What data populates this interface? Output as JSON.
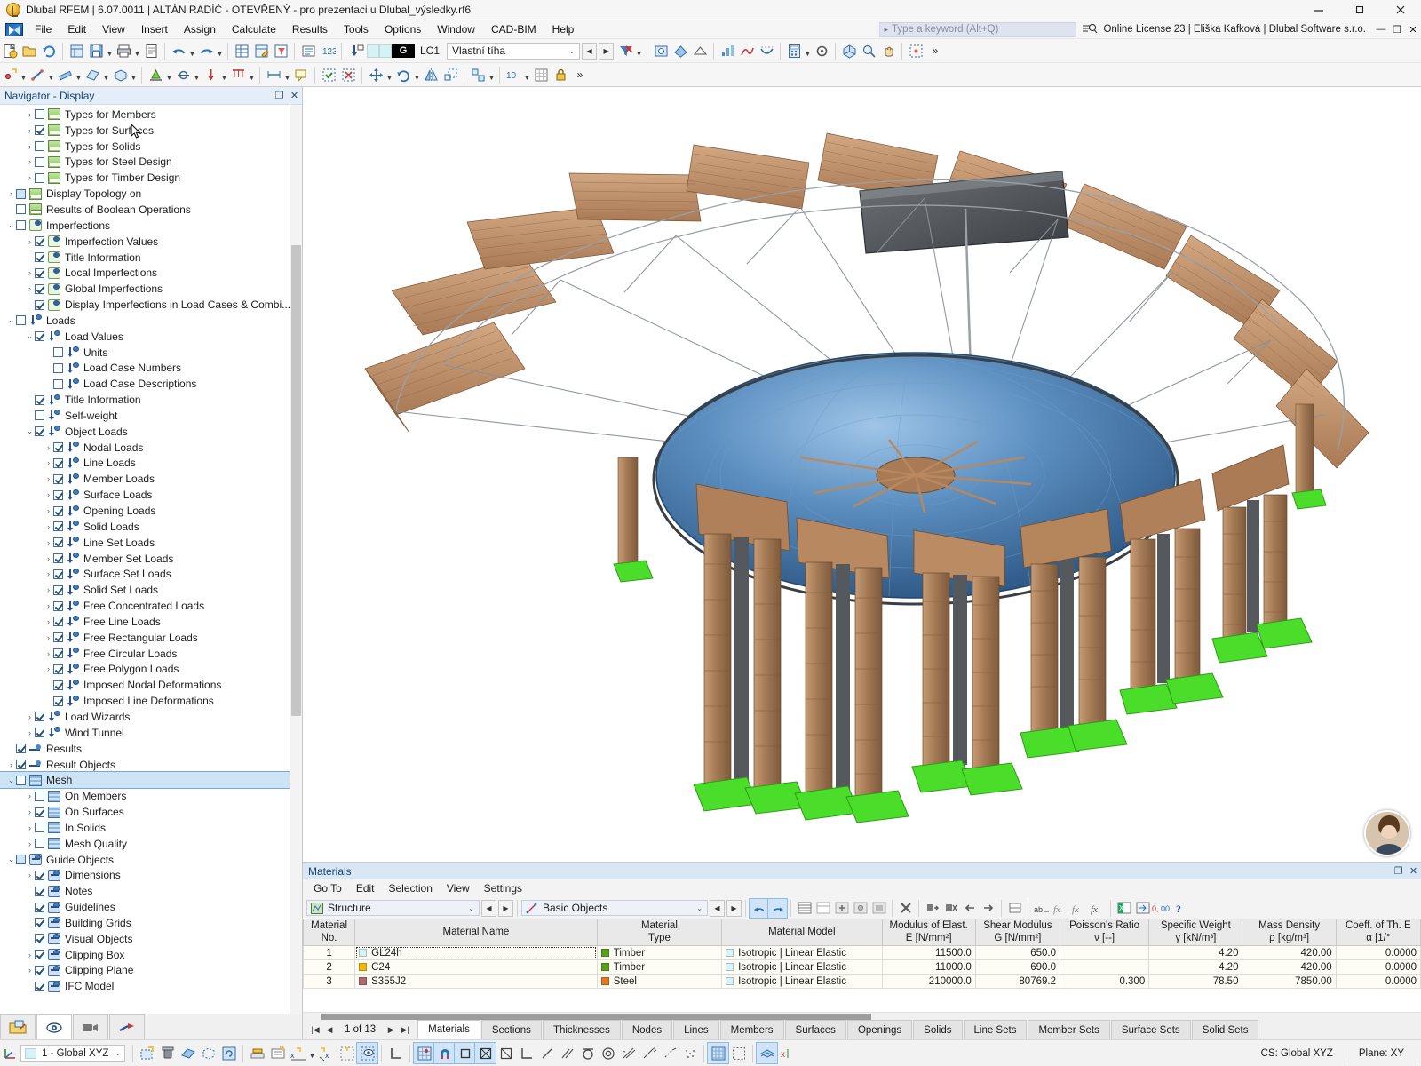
{
  "window": {
    "title": "Dlubal RFEM | 6.07.0011 | ALTÁN RADÍČ - OTEVŘENÝ - pro prezentaci u Dlubal_výsledky.rf6",
    "minimize": "—",
    "maximize": "❐",
    "close": "✕"
  },
  "menu": {
    "items": [
      "File",
      "Edit",
      "View",
      "Insert",
      "Assign",
      "Calculate",
      "Results",
      "Tools",
      "Options",
      "Window",
      "CAD-BIM",
      "Help"
    ],
    "search_placeholder": "Type a keyword (Alt+Q)",
    "search_caret": "▸",
    "license": "Online License 23 | Eliška Kafková | Dlubal Software s.r.o.",
    "doc_minimize": "—",
    "doc_restore": "❐",
    "doc_close": "✕"
  },
  "toolbar": {
    "load_case": {
      "badge": "G",
      "number": "LC1",
      "name": "Vlastní tíha",
      "dropdown_arrow": "⌄",
      "prev": "◀",
      "next": "▶"
    }
  },
  "navigator": {
    "title": "Navigator - Display",
    "float_icon": "❐",
    "close_icon": "✕",
    "tree": [
      {
        "label": "Types for Members",
        "indent": 1,
        "expander": "›",
        "check": "off",
        "icon": "ruler-icon"
      },
      {
        "label": "Types for Surfaces",
        "indent": 1,
        "expander": "›",
        "check": "on",
        "icon": "ruler-icon"
      },
      {
        "label": "Types for Solids",
        "indent": 1,
        "expander": "›",
        "check": "off",
        "icon": "ruler-icon"
      },
      {
        "label": "Types for Steel Design",
        "indent": 1,
        "expander": "›",
        "check": "off",
        "icon": "ruler-icon"
      },
      {
        "label": "Types for Timber Design",
        "indent": 1,
        "expander": "›",
        "check": "off",
        "icon": "ruler-icon"
      },
      {
        "label": "Display Topology on",
        "indent": 0,
        "expander": "›",
        "check": "part",
        "icon": "ruler-icon"
      },
      {
        "label": "Results of Boolean Operations",
        "indent": 0,
        "expander": "",
        "check": "off",
        "icon": "ruler-icon"
      },
      {
        "label": "Imperfections",
        "indent": 0,
        "expander": "⌄",
        "check": "off",
        "icon": "imperfection-icon"
      },
      {
        "label": "Imperfection Values",
        "indent": 1,
        "expander": "›",
        "check": "on",
        "icon": "imperfection-icon"
      },
      {
        "label": "Title Information",
        "indent": 1,
        "expander": "",
        "check": "on",
        "icon": "imperfection-icon"
      },
      {
        "label": "Local Imperfections",
        "indent": 1,
        "expander": "›",
        "check": "on",
        "icon": "imperfection-icon"
      },
      {
        "label": "Global Imperfections",
        "indent": 1,
        "expander": "›",
        "check": "on",
        "icon": "imperfection-icon"
      },
      {
        "label": "Display Imperfections in Load Cases & Combi...",
        "indent": 1,
        "expander": "",
        "check": "on",
        "icon": "imperfection-icon"
      },
      {
        "label": "Loads",
        "indent": 0,
        "expander": "⌄",
        "check": "off",
        "icon": "load-icon"
      },
      {
        "label": "Load Values",
        "indent": 1,
        "expander": "⌄",
        "check": "on",
        "icon": "load-icon"
      },
      {
        "label": "Units",
        "indent": 2,
        "expander": "",
        "check": "off",
        "icon": "load-icon"
      },
      {
        "label": "Load Case Numbers",
        "indent": 2,
        "expander": "",
        "check": "off",
        "icon": "load-icon"
      },
      {
        "label": "Load Case Descriptions",
        "indent": 2,
        "expander": "",
        "check": "off",
        "icon": "load-icon"
      },
      {
        "label": "Title Information",
        "indent": 1,
        "expander": "",
        "check": "on",
        "icon": "load-icon"
      },
      {
        "label": "Self-weight",
        "indent": 1,
        "expander": "",
        "check": "off",
        "icon": "load-icon"
      },
      {
        "label": "Object Loads",
        "indent": 1,
        "expander": "⌄",
        "check": "on",
        "icon": "load-icon"
      },
      {
        "label": "Nodal Loads",
        "indent": 2,
        "expander": "›",
        "check": "on",
        "icon": "load-icon"
      },
      {
        "label": "Line Loads",
        "indent": 2,
        "expander": "›",
        "check": "on",
        "icon": "load-icon"
      },
      {
        "label": "Member Loads",
        "indent": 2,
        "expander": "›",
        "check": "on",
        "icon": "load-icon"
      },
      {
        "label": "Surface Loads",
        "indent": 2,
        "expander": "›",
        "check": "on",
        "icon": "load-icon"
      },
      {
        "label": "Opening Loads",
        "indent": 2,
        "expander": "›",
        "check": "on",
        "icon": "load-icon"
      },
      {
        "label": "Solid Loads",
        "indent": 2,
        "expander": "›",
        "check": "on",
        "icon": "load-icon"
      },
      {
        "label": "Line Set Loads",
        "indent": 2,
        "expander": "›",
        "check": "on",
        "icon": "load-icon"
      },
      {
        "label": "Member Set Loads",
        "indent": 2,
        "expander": "›",
        "check": "on",
        "icon": "load-icon"
      },
      {
        "label": "Surface Set Loads",
        "indent": 2,
        "expander": "›",
        "check": "on",
        "icon": "load-icon"
      },
      {
        "label": "Solid Set Loads",
        "indent": 2,
        "expander": "›",
        "check": "on",
        "icon": "load-icon"
      },
      {
        "label": "Free Concentrated Loads",
        "indent": 2,
        "expander": "›",
        "check": "on",
        "icon": "load-icon"
      },
      {
        "label": "Free Line Loads",
        "indent": 2,
        "expander": "›",
        "check": "on",
        "icon": "load-icon"
      },
      {
        "label": "Free Rectangular Loads",
        "indent": 2,
        "expander": "›",
        "check": "on",
        "icon": "load-icon"
      },
      {
        "label": "Free Circular Loads",
        "indent": 2,
        "expander": "›",
        "check": "on",
        "icon": "load-icon"
      },
      {
        "label": "Free Polygon Loads",
        "indent": 2,
        "expander": "›",
        "check": "on",
        "icon": "load-icon"
      },
      {
        "label": "Imposed Nodal Deformations",
        "indent": 2,
        "expander": "",
        "check": "on",
        "icon": "load-icon"
      },
      {
        "label": "Imposed Line Deformations",
        "indent": 2,
        "expander": "",
        "check": "on",
        "icon": "load-icon"
      },
      {
        "label": "Load Wizards",
        "indent": 1,
        "expander": "›",
        "check": "on",
        "icon": "load-icon"
      },
      {
        "label": "Wind Tunnel",
        "indent": 1,
        "expander": "›",
        "check": "on",
        "icon": "load-icon"
      },
      {
        "label": "Results",
        "indent": 0,
        "expander": "",
        "check": "on",
        "icon": "results-icon"
      },
      {
        "label": "Result Objects",
        "indent": 0,
        "expander": "›",
        "check": "on",
        "icon": "results-icon"
      },
      {
        "label": "Mesh",
        "indent": 0,
        "expander": "⌄",
        "check": "off",
        "icon": "mesh-icon",
        "selected": true
      },
      {
        "label": "On Members",
        "indent": 1,
        "expander": "›",
        "check": "off",
        "icon": "mesh-icon"
      },
      {
        "label": "On Surfaces",
        "indent": 1,
        "expander": "›",
        "check": "on",
        "icon": "mesh-icon"
      },
      {
        "label": "In Solids",
        "indent": 1,
        "expander": "›",
        "check": "off",
        "icon": "mesh-icon"
      },
      {
        "label": "Mesh Quality",
        "indent": 1,
        "expander": "›",
        "check": "off",
        "icon": "mesh-icon"
      },
      {
        "label": "Guide Objects",
        "indent": 0,
        "expander": "⌄",
        "check": "part",
        "icon": "guide-icon"
      },
      {
        "label": "Dimensions",
        "indent": 1,
        "expander": "›",
        "check": "on",
        "icon": "guide-icon"
      },
      {
        "label": "Notes",
        "indent": 1,
        "expander": "",
        "check": "on",
        "icon": "guide-icon"
      },
      {
        "label": "Guidelines",
        "indent": 1,
        "expander": "",
        "check": "on",
        "icon": "guide-icon"
      },
      {
        "label": "Building Grids",
        "indent": 1,
        "expander": "",
        "check": "on",
        "icon": "guide-icon"
      },
      {
        "label": "Visual Objects",
        "indent": 1,
        "expander": "",
        "check": "on",
        "icon": "guide-icon"
      },
      {
        "label": "Clipping Box",
        "indent": 1,
        "expander": "›",
        "check": "on",
        "icon": "guide-icon"
      },
      {
        "label": "Clipping Plane",
        "indent": 1,
        "expander": "›",
        "check": "on",
        "icon": "guide-icon"
      },
      {
        "label": "IFC Model",
        "indent": 1,
        "expander": "",
        "check": "on",
        "icon": "guide-icon"
      }
    ],
    "mini_tabs": [
      "project-navigator-tab",
      "display-tab",
      "views-tab",
      "results-tab"
    ]
  },
  "materials": {
    "panel_title": "Materials",
    "float_icon": "❐",
    "close_icon": "✕",
    "menu": [
      "Go To",
      "Edit",
      "Selection",
      "View",
      "Settings"
    ],
    "filter1": {
      "value": "Structure",
      "arrow": "⌄",
      "prev": "◀",
      "next": "▶"
    },
    "filter2": {
      "value": "Basic Objects",
      "arrow": "⌄",
      "prev": "◀",
      "next": "▶"
    },
    "columns": [
      {
        "line1": "Material",
        "line2": "No."
      },
      {
        "line1": "",
        "line2": "Material Name"
      },
      {
        "line1": "Material",
        "line2": "Type"
      },
      {
        "line1": "",
        "line2": "Material Model"
      },
      {
        "line1": "Modulus of Elast.",
        "line2": "E [N/mm²]"
      },
      {
        "line1": "Shear Modulus",
        "line2": "G [N/mm²]"
      },
      {
        "line1": "Poisson's Ratio",
        "line2": "ν [--]"
      },
      {
        "line1": "Specific Weight",
        "line2": "γ [kN/m³]"
      },
      {
        "line1": "Mass Density",
        "line2": "ρ [kg/m³]"
      },
      {
        "line1": "Coeff. of Th. E",
        "line2": "α [1/°"
      }
    ],
    "rows": [
      {
        "no": "1",
        "name": "GL24h",
        "name_color": "#d9f4f8",
        "type": "Timber",
        "type_color": "#5aa11a",
        "model": "Isotropic | Linear Elastic",
        "model_color": "#d9f4f8",
        "e": "11500.0",
        "g": "650.0",
        "nu": "",
        "gamma": "4.20",
        "rho": "420.00",
        "alpha": "0.0000"
      },
      {
        "no": "2",
        "name": "C24",
        "name_color": "#f2b705",
        "type": "Timber",
        "type_color": "#5aa11a",
        "model": "Isotropic | Linear Elastic",
        "model_color": "#d9f4f8",
        "e": "11000.0",
        "g": "690.0",
        "nu": "",
        "gamma": "4.20",
        "rho": "420.00",
        "alpha": "0.0000"
      },
      {
        "no": "3",
        "name": "S355J2",
        "name_color": "#b0696e",
        "type": "Steel",
        "type_color": "#e8761f",
        "model": "Isotropic | Linear Elastic",
        "model_color": "#d9f4f8",
        "e": "210000.0",
        "g": "80769.2",
        "nu": "0.300",
        "gamma": "78.50",
        "rho": "7850.00",
        "alpha": "0.0000"
      }
    ],
    "pager": {
      "first": "|◀",
      "prev": "◀",
      "text": "1 of 13",
      "next": "▶",
      "last": "▶|"
    },
    "tabs": [
      {
        "label": "Materials",
        "active": true
      },
      {
        "label": "Sections",
        "active": false
      },
      {
        "label": "Thicknesses",
        "active": false
      },
      {
        "label": "Nodes",
        "active": false
      },
      {
        "label": "Lines",
        "active": false
      },
      {
        "label": "Members",
        "active": false
      },
      {
        "label": "Surfaces",
        "active": false
      },
      {
        "label": "Openings",
        "active": false
      },
      {
        "label": "Solids",
        "active": false
      },
      {
        "label": "Line Sets",
        "active": false
      },
      {
        "label": "Member Sets",
        "active": false
      },
      {
        "label": "Surface Sets",
        "active": false
      },
      {
        "label": "Solid Sets",
        "active": false
      }
    ]
  },
  "statusbar": {
    "coord_system": "1 - Global XYZ",
    "coord_arrow": "⌄",
    "cs_label": "CS: Global XYZ",
    "plane_label": "Plane: XY",
    "snap_count": "10"
  },
  "model": {
    "description": "3D rendered timber pavilion structure with circular roof, radial glulam beams, steel tension rods, column clusters on green supports and a dark sign panel"
  }
}
